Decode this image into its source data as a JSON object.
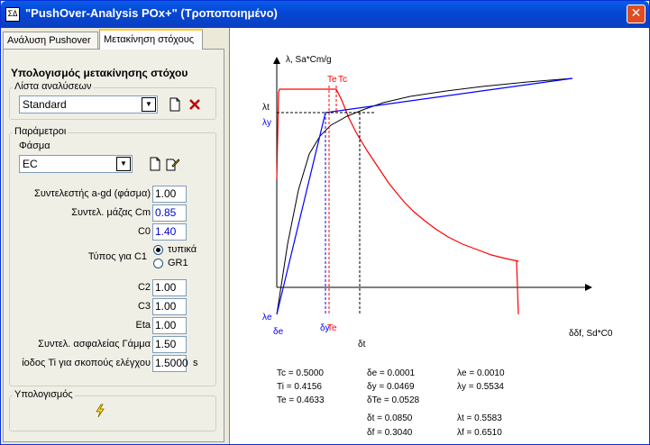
{
  "window": {
    "title": "\"PushOver-Analysis  POx+\" (Τροποποιημένο)",
    "app_icon": "ΣΔ",
    "close_symbol": "✕"
  },
  "tabs": [
    {
      "label": "Ανάλυση Pushover",
      "active": false
    },
    {
      "label": "Μετακίνηση στόχους",
      "active": true
    }
  ],
  "section_title": "Υπολογισμός μετακίνησης στόχου",
  "analysis_list": {
    "group_label": "Λίστα αναλύσεων",
    "selected": "Standard"
  },
  "parameters": {
    "group_label": "Παράμετροι",
    "spectrum_label": "Φάσμα",
    "spectrum_selected": "EC",
    "agd_label": "Συντελεστής a-gd (φάσμα)",
    "agd_value": "1.00",
    "cm_label": "Συντελ. μάζας Cm",
    "cm_value": "0.85",
    "c0_label": "C0",
    "c0_value": "1.40",
    "c1_type_label": "Τύπος για C1",
    "c1_option_1": "τυπικά",
    "c1_option_2": "GR1",
    "c2_label": "C2",
    "c2_value": "1.00",
    "c3_label": "C3",
    "c3_value": "1.00",
    "eta_label": "Eta",
    "eta_value": "1.00",
    "gamma_label": "Συντελ. ασφαλείας Γάμμα",
    "gamma_value": "1.50",
    "ti_label": "ίοδος Ti για σκοπούς ελέγχου",
    "ti_value": "1.5000",
    "ti_unit": "s"
  },
  "calculation": {
    "group_label": "Υπολογισμός",
    "run_icon": "lightning-icon"
  },
  "plot": {
    "y_axis_label": "λ, Sa*Cm/g",
    "x_axis_label": "δδf, Sd*C0",
    "tick_lambda_t": "λt",
    "tick_lambda_y": "λy",
    "tick_lambda_e": "λe",
    "tick_delta_e": "δe",
    "tick_delta_y": "δy",
    "tick_delta_te": "Te",
    "tick_delta_t": "δt",
    "top_te": "Te",
    "top_tc": "Tc",
    "colors": {
      "spectrum": "#FF0000",
      "bilinear": "#0000FF",
      "pushover": "#000000"
    }
  },
  "results": {
    "col1": [
      "Tc = 0.5000",
      "Ti = 0.4156",
      "Te = 0.4633"
    ],
    "col2": [
      "δe = 0.0001",
      "δy = 0.0469",
      "δTe = 0.0528",
      "δt = 0.0850",
      "δf = 0.3040"
    ],
    "col3": [
      "λe = 0.0010",
      "λy = 0.5534",
      "λt = 0.5583",
      "λf = 0.6510"
    ]
  },
  "chart_data": {
    "type": "line",
    "x_label": "δδf, Sd*C0",
    "y_label": "λ, Sa*Cm/g",
    "markers": {
      "Tc": 0.5,
      "Ti": 0.4156,
      "Te": 0.4633,
      "delta_e": 0.0001,
      "delta_y": 0.0469,
      "delta_Te": 0.0528,
      "delta_t": 0.085,
      "delta_f": 0.304,
      "lambda_e": 0.001,
      "lambda_y": 0.5534,
      "lambda_t": 0.5583,
      "lambda_f": 0.651
    }
  }
}
